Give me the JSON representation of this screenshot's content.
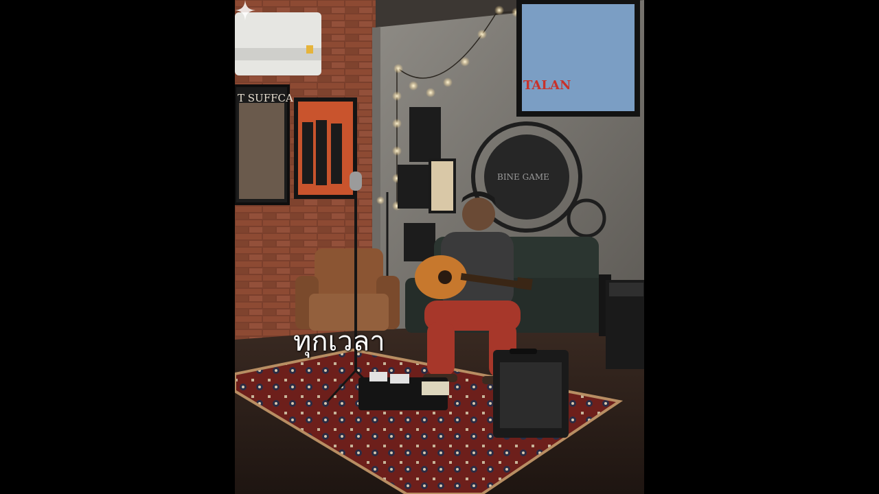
{
  "video": {
    "caption": "ทุกเวลา",
    "watermark_icon": "sparkle-icon"
  },
  "scene": {
    "posters": [
      {
        "name": "poster-left-band",
        "title": "T SUFFCA"
      },
      {
        "name": "poster-red-band",
        "title": ""
      },
      {
        "name": "poster-small",
        "title": ""
      },
      {
        "name": "poster-top-right",
        "title": "TALAN"
      }
    ],
    "wall_sign": "BINE GAME"
  }
}
